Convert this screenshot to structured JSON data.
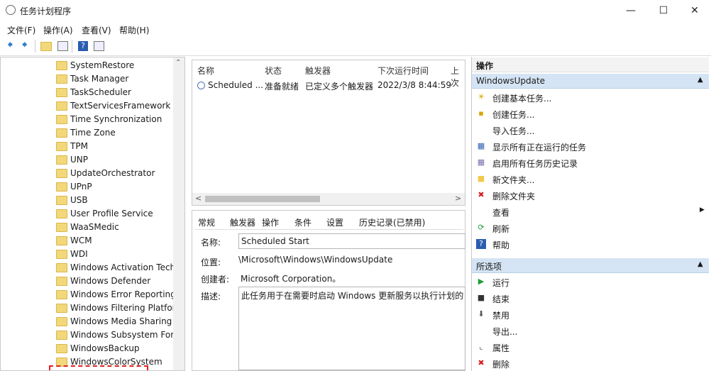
{
  "window": {
    "title": "任务计划程序"
  },
  "menu": [
    "文件(F)",
    "操作(A)",
    "查看(V)",
    "帮助(H)"
  ],
  "tree": [
    "SystemRestore",
    "Task Manager",
    "TaskScheduler",
    "TextServicesFramework",
    "Time Synchronization",
    "Time Zone",
    "TPM",
    "UNP",
    "UpdateOrchestrator",
    "UPnP",
    "USB",
    "User Profile Service",
    "WaaSMedic",
    "WCM",
    "WDI",
    "Windows Activation Technologies",
    "Windows Defender",
    "Windows Error Reporting",
    "Windows Filtering Platform",
    "Windows Media Sharing",
    "Windows Subsystem For Linux",
    "WindowsBackup",
    "WindowsColorSystem"
  ],
  "list": {
    "headers": [
      "名称",
      "状态",
      "触发器",
      "下次运行时间",
      "上次"
    ],
    "rows": [
      [
        "Scheduled ...",
        "准备就绪",
        "已定义多个触发器",
        "2022/3/8 8:44:59",
        ""
      ]
    ]
  },
  "detail": {
    "tabs": [
      "常规",
      "触发器",
      "操作",
      "条件",
      "设置",
      "历史记录(已禁用)"
    ],
    "name_label": "名称:",
    "name_value": "Scheduled Start",
    "location_label": "位置:",
    "location_value": "\\Microsoft\\Windows\\WindowsUpdate",
    "author_label": "创建者:",
    "author_value": "Microsoft Corporation。",
    "desc_label": "描述:",
    "desc_value": "此任务用于在需要时启动 Windows 更新服务以执行计划的"
  },
  "actions": {
    "header": "操作",
    "section1": "WindowsUpdate",
    "items1": [
      "创建基本任务...",
      "创建任务...",
      "导入任务...",
      "显示所有正在运行的任务",
      "启用所有任务历史记录",
      "新文件夹...",
      "删除文件夹",
      "查看",
      "刷新",
      "帮助"
    ],
    "section2": "所选项",
    "items2": [
      "运行",
      "结束",
      "禁用",
      "导出...",
      "属性",
      "删除"
    ]
  }
}
